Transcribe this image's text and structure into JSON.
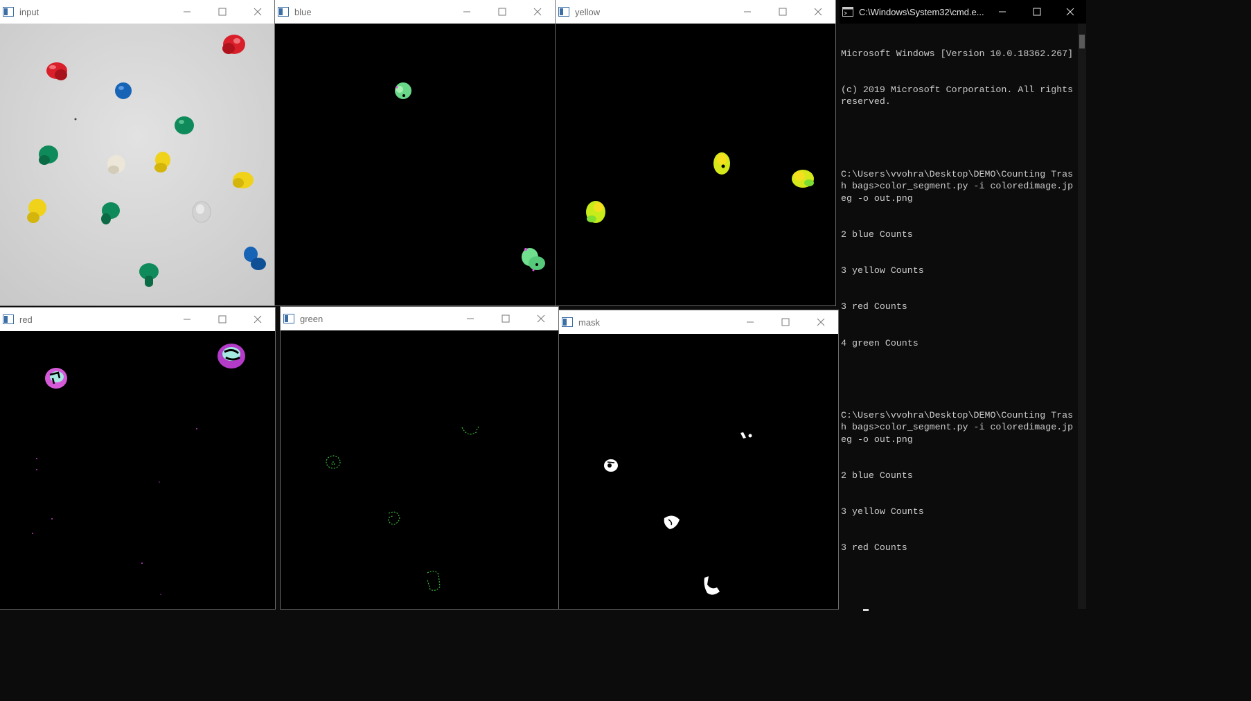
{
  "windows": {
    "input": {
      "title": "input"
    },
    "blue": {
      "title": "blue"
    },
    "yellow": {
      "title": "yellow"
    },
    "red": {
      "title": "red"
    },
    "green": {
      "title": "green"
    },
    "mask": {
      "title": "mask"
    }
  },
  "console": {
    "title": "C:\\Windows\\System32\\cmd.e...",
    "lines": [
      "Microsoft Windows [Version 10.0.18362.267]",
      "(c) 2019 Microsoft Corporation. All rights reserved.",
      "",
      "C:\\Users\\vvohra\\Desktop\\DEMO\\Counting Trash bags>color_segment.py -i coloredimage.jpeg -o out.png",
      "2 blue Counts",
      "3 yellow Counts",
      "3 red Counts",
      "4 green Counts",
      "",
      "C:\\Users\\vvohra\\Desktop\\DEMO\\Counting Trash bags>color_segment.py -i coloredimage.jpeg -o out.png",
      "2 blue Counts",
      "3 yellow Counts",
      "3 red Counts"
    ]
  },
  "icons": {
    "window_icon": "opencv-window-icon",
    "minimize": "minimize-icon",
    "maximize": "maximize-icon",
    "close": "close-icon"
  },
  "colors": {
    "titlebar": "#ffffff",
    "console_bg": "#0c0c0c",
    "console_text": "#cccccc",
    "pin_red": "#d9202a",
    "pin_blue": "#1763b5",
    "pin_green": "#0f8a5a",
    "pin_yellow": "#f0d21a"
  }
}
